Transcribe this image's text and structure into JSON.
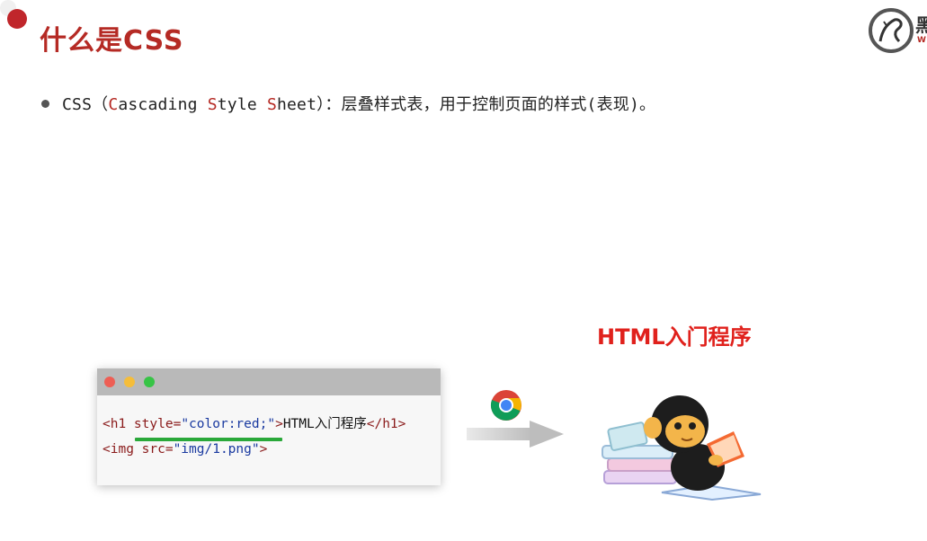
{
  "slide": {
    "title": "什么是CSS",
    "logo_text": "黑",
    "logo_sub": "W"
  },
  "bullet": {
    "before": "CSS（",
    "c": "C",
    "ascading": "ascading ",
    "s": "S",
    "tyle": "tyle ",
    "sh": "S",
    "heet": "heet）：层叠样式表，用于控制页面的样式(表现)。"
  },
  "code": {
    "line1": {
      "open_tag": "<h1 ",
      "attr": "style=",
      "value": "\"color:red;\"",
      "close": ">",
      "text": "HTML入门程序",
      "end_tag": "</h1>"
    },
    "line2": {
      "open_tag": "<img ",
      "attr": "src=",
      "value": "\"img/1.png\"",
      "close": ">"
    }
  },
  "result": {
    "title": "HTML入门程序"
  },
  "colors": {
    "title": "#b52a24",
    "result_title": "#e0211c",
    "underline": "#2aa83a",
    "dot_red": "#ee5e54",
    "dot_yellow": "#f5bd3a",
    "dot_green": "#37c446"
  },
  "icons": {
    "browser": "chrome-icon",
    "arrow": "right-arrow-icon",
    "logo": "horse-logo-icon",
    "mascot": "monkey-reading-icon"
  }
}
